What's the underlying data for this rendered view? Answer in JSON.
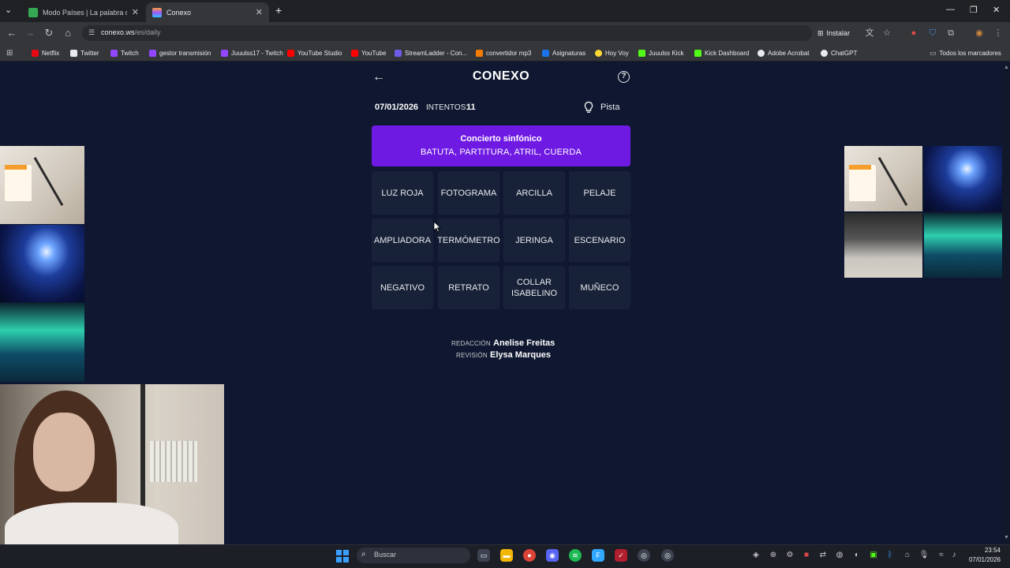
{
  "browser": {
    "tabs": [
      {
        "title": "Modo Países | La palabra del d"
      },
      {
        "title": "Conexo"
      }
    ],
    "url_host": "conexo.ws",
    "url_path": "/es/daily",
    "install_label": "Instalar",
    "bookmarks": [
      {
        "label": "Netflix",
        "color": "#e50914"
      },
      {
        "label": "Twitter",
        "color": "#e8eaed"
      },
      {
        "label": "Twitch",
        "color": "#9146ff"
      },
      {
        "label": "gestor transmisión",
        "color": "#9146ff"
      },
      {
        "label": "Juuulss17 - Twitch",
        "color": "#9146ff"
      },
      {
        "label": "YouTube Studio",
        "color": "#ff0000"
      },
      {
        "label": "YouTube",
        "color": "#ff0000"
      },
      {
        "label": "StreamLadder - Con...",
        "color": "#6c5ce7"
      },
      {
        "label": "convertidor mp3",
        "color": "#f57c00"
      },
      {
        "label": "Asignaturas",
        "color": "#1a73e8"
      },
      {
        "label": "Hoy Voy",
        "color": "#fdd835"
      },
      {
        "label": "Juuulss Kick",
        "color": "#53fc18"
      },
      {
        "label": "Kick Dashboard",
        "color": "#53fc18"
      },
      {
        "label": "Adobe Acrobat",
        "color": "#e8eaed"
      },
      {
        "label": "ChatGPT",
        "color": "#e8eaed"
      }
    ],
    "all_bookmarks_label": "Todos los marcadores"
  },
  "game": {
    "title": "CONEXO",
    "date": "07/01/2026",
    "attempts_label": "INTENTOS:",
    "attempts_value": "11",
    "hint_label": "Pista",
    "solved_group": {
      "title": "Concierto sinfónico",
      "words": "BATUTA, PARTITURA, ATRIL, CUERDA",
      "color": "#6f1ae3"
    },
    "tiles": [
      "LUZ ROJA",
      "FOTOGRAMA",
      "ARCILLA",
      "PELAJE",
      "AMPLIADORA",
      "TERMÓMETRO",
      "JERINGA",
      "ESCENARIO",
      "NEGATIVO",
      "RETRATO",
      "COLLAR ISABELINO",
      "MUÑECO"
    ],
    "credits": {
      "editing_label": "REDACCIÓN",
      "editing_name": "Anelise Freitas",
      "review_label": "REVISIÓN",
      "review_name": "Elysa Marques"
    }
  },
  "taskbar": {
    "search_placeholder": "Buscar",
    "time": "23:54",
    "date": "07/01/2026"
  },
  "colors": {
    "page_background": "#0f1830",
    "tile_background": "#172238",
    "accent_purple": "#6f1ae3"
  }
}
